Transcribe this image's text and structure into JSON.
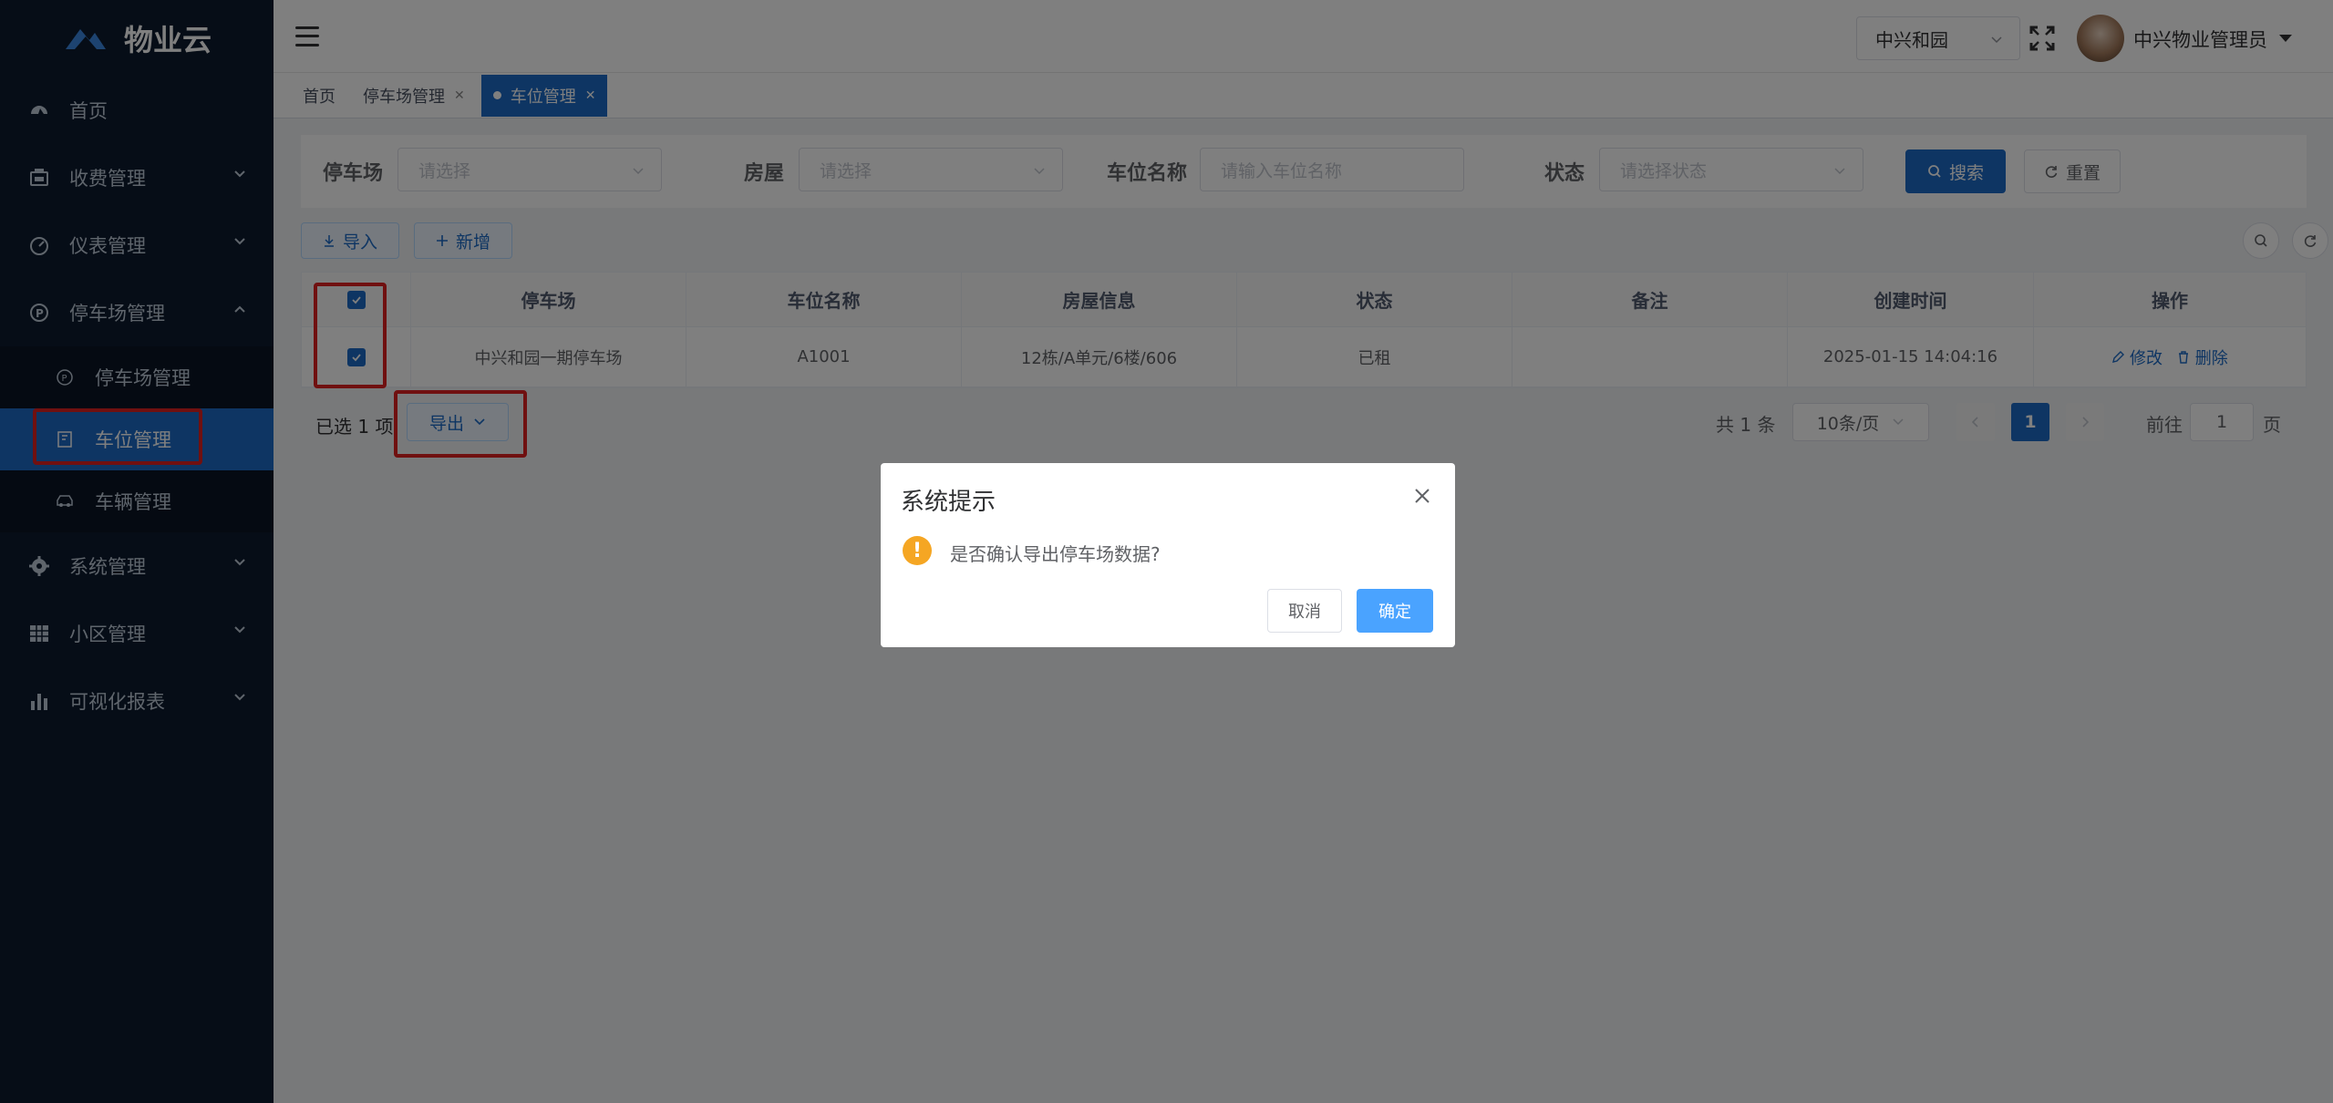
{
  "app": {
    "logo_text": "物业云"
  },
  "sidebar": {
    "items": [
      {
        "label": "首页",
        "icon": "dashboard-icon"
      },
      {
        "label": "收费管理",
        "icon": "cash-register-icon"
      },
      {
        "label": "仪表管理",
        "icon": "meter-icon"
      },
      {
        "label": "停车场管理",
        "icon": "parking-circle-icon",
        "expanded": true
      },
      {
        "label": "系统管理",
        "icon": "gear-icon"
      },
      {
        "label": "小区管理",
        "icon": "grid-icon"
      },
      {
        "label": "可视化报表",
        "icon": "bar-chart-icon"
      }
    ],
    "sub_items": [
      {
        "label": "停车场管理",
        "icon": "parking-p-icon"
      },
      {
        "label": "车位管理",
        "icon": "parking-space-icon",
        "active": true
      },
      {
        "label": "车辆管理",
        "icon": "car-icon"
      }
    ]
  },
  "navbar": {
    "community": "中兴和园",
    "user_name": "中兴物业管理员"
  },
  "tags": [
    {
      "label": "首页"
    },
    {
      "label": "停车场管理"
    },
    {
      "label": "车位管理",
      "active": true
    }
  ],
  "search": {
    "parking_label": "停车场",
    "parking_placeholder": "请选择",
    "house_label": "房屋",
    "house_placeholder": "请选择",
    "space_label": "车位名称",
    "space_placeholder": "请输入车位名称",
    "status_label": "状态",
    "status_placeholder": "请选择状态",
    "search_button": "搜索",
    "reset_button": "重置"
  },
  "toolbar": {
    "import_button": "导入",
    "add_button": "新增"
  },
  "table": {
    "columns": [
      "停车场",
      "车位名称",
      "房屋信息",
      "状态",
      "备注",
      "创建时间",
      "操作"
    ],
    "rows": [
      {
        "parking": "中兴和园一期停车场",
        "space": "A1001",
        "house": "12栋/A单元/6楼/606",
        "status": "已租",
        "remark": "",
        "created": "2025-01-15 14:04:16",
        "edit": "修改",
        "delete": "删除"
      }
    ]
  },
  "selection": {
    "text": "已选 1 项",
    "export_button": "导出"
  },
  "pagination": {
    "total": "共 1 条",
    "page_size": "10条/页",
    "current": "1",
    "goto_prefix": "前往",
    "goto_value": "1",
    "goto_suffix": "页"
  },
  "dialog": {
    "title": "系统提示",
    "message": "是否确认导出停车场数据?",
    "cancel": "取消",
    "confirm": "确定"
  },
  "colors": {
    "sidebar_bg": "#0d1b2f",
    "primary": "#1c6bc6",
    "highlight": "#e02020",
    "warning": "#f5a623"
  }
}
